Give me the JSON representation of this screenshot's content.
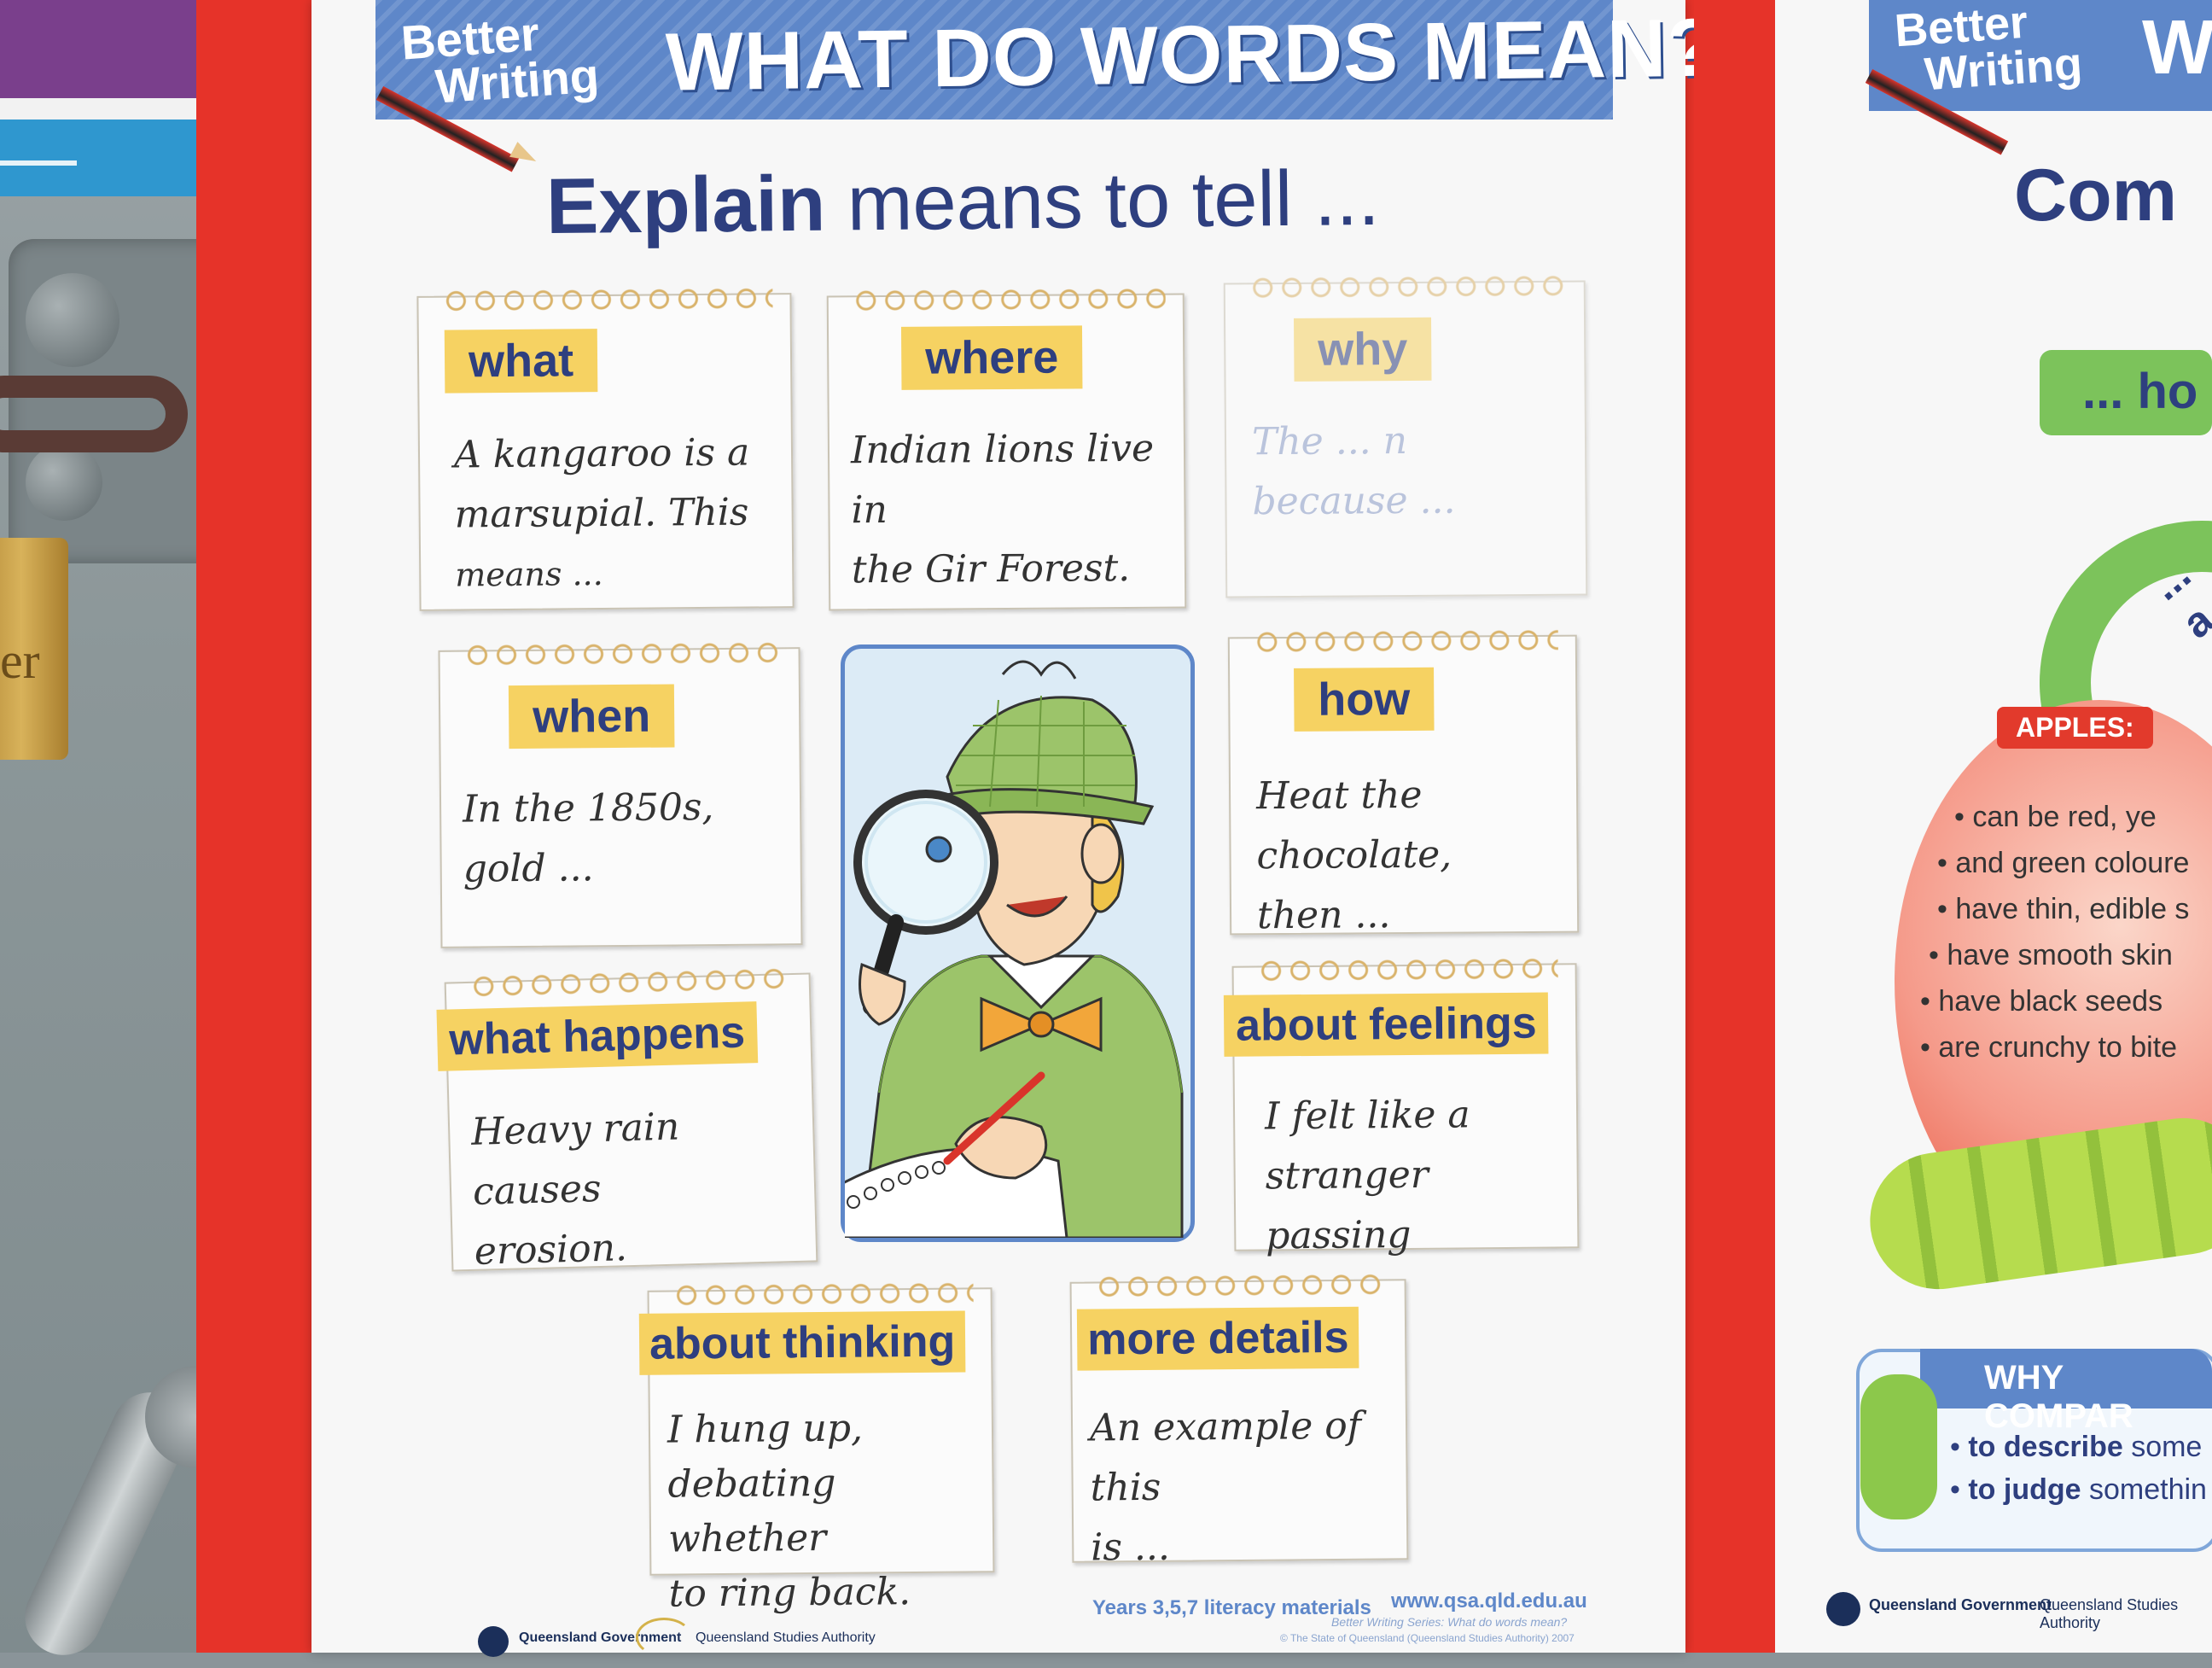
{
  "poster": {
    "banner": {
      "brand_line1": "Better",
      "brand_line2": "Writing",
      "title": "WHAT DO WORDS MEAN?"
    },
    "headline": {
      "keyword": "Explain",
      "rest": "means to tell ..."
    },
    "cards": [
      {
        "tag": "what",
        "lines": [
          "A kangaroo is a",
          "marsupial. This",
          "means ..."
        ]
      },
      {
        "tag": "where",
        "lines": [
          "Indian lions live in",
          "the Gir Forest."
        ]
      },
      {
        "tag": "why",
        "lines": [
          "The ... n",
          "because ..."
        ]
      },
      {
        "tag": "when",
        "lines": [
          "In the 1850s, gold ..."
        ]
      },
      {
        "tag": "how",
        "lines": [
          "Heat the chocolate,",
          "then ..."
        ]
      },
      {
        "tag": "what happens",
        "lines": [
          "Heavy rain causes",
          "erosion."
        ]
      },
      {
        "tag": "about feelings",
        "lines": [
          "I felt like a",
          "stranger passing"
        ]
      },
      {
        "tag": "about thinking",
        "lines": [
          "I hung up,",
          "debating whether",
          "to ring back."
        ]
      },
      {
        "tag": "more details",
        "lines": [
          "An example of this",
          "is ..."
        ]
      }
    ],
    "footer": {
      "years": "Years 3,5,7 literacy materials",
      "url": "www.qsa.qld.edu.au",
      "series": "Better Writing Series: What do words mean?",
      "copyright": "© The State of Queensland (Queensland Studies Authority) 2007",
      "logo_qgov": "Queensland Government",
      "logo_qsa": "Queensland Studies Authority"
    }
  },
  "right_poster": {
    "brand_line1": "Better",
    "brand_line2": "Writing",
    "title_fragment": "W",
    "headline": "Com",
    "arrow_label": "... ho",
    "arc_label": "... a",
    "apples_badge": "APPLES:",
    "apple_facts": [
      "can be red, ye",
      "and green coloure",
      "have thin, edible s",
      "have smooth skin",
      "have black seeds",
      "are crunchy to bite"
    ],
    "why_title": "WHY COMPAR",
    "why_items": [
      {
        "bold": "to describe",
        "rest": " some"
      },
      {
        "bold": "to judge",
        "rest": " somethin"
      }
    ],
    "logo_qgov": "Queensland Government",
    "logo_qsa": "Queensland Studies Authority"
  },
  "background": {
    "padlock_text": "er"
  },
  "colors": {
    "red_board": "#e63329",
    "banner_blue": "#5e87c9",
    "tag_yellow": "#f6d262",
    "navy_text": "#2e3f7f"
  }
}
